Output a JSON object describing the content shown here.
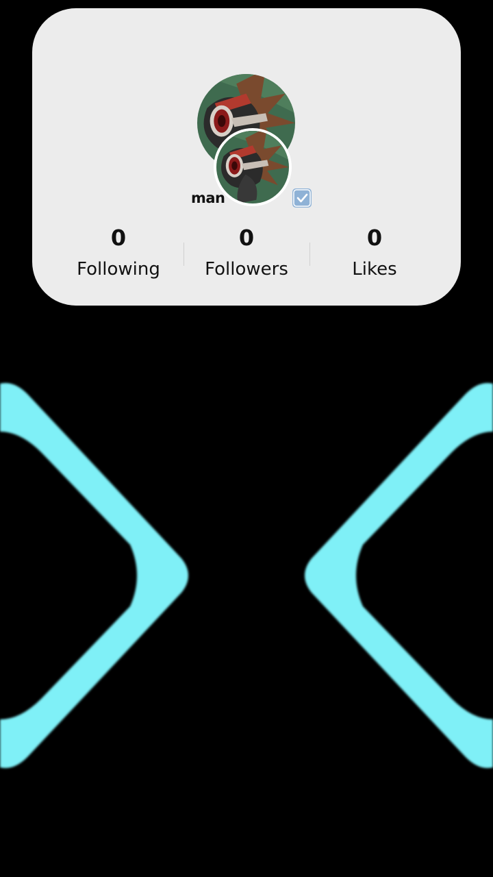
{
  "profile": {
    "username": "man",
    "verified_icon": "verified-check-icon",
    "avatar_description_icon": "creature-avatar"
  },
  "stats": [
    {
      "value": "0",
      "label": "Following"
    },
    {
      "value": "0",
      "label": "Followers"
    },
    {
      "value": "0",
      "label": "Likes"
    }
  ],
  "colors": {
    "background": "#000000",
    "card": "#ececec",
    "accent_cyan": "#7ff0f7",
    "text": "#111111",
    "badge": "#8fb2d6"
  }
}
